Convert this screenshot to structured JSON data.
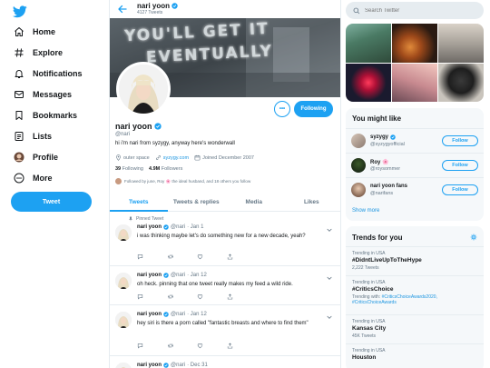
{
  "colors": {
    "accent": "#1da1f2",
    "text": "#14171a",
    "muted": "#657786",
    "border": "#e6ecf0",
    "panel": "#f5f8fa"
  },
  "nav": {
    "logo_icon": "twitter-bird-icon",
    "items": [
      {
        "label": "Home",
        "icon": "home-icon"
      },
      {
        "label": "Explore",
        "icon": "hashtag-icon"
      },
      {
        "label": "Notifications",
        "icon": "bell-icon"
      },
      {
        "label": "Messages",
        "icon": "envelope-icon"
      },
      {
        "label": "Bookmarks",
        "icon": "bookmark-icon"
      },
      {
        "label": "Lists",
        "icon": "list-icon"
      },
      {
        "label": "Profile",
        "icon": "avatar-icon"
      },
      {
        "label": "More",
        "icon": "more-circle-icon"
      }
    ],
    "tweet_button": "Tweet"
  },
  "header": {
    "name": "nari yoon",
    "tweet_count": "4127 Tweets"
  },
  "banner": {
    "line1": "YOU'LL GET IT",
    "line2": "EVENTUALLY"
  },
  "profile": {
    "name": "nari yoon",
    "handle": "@nari",
    "bio": "hi i'm nari from syzygy, anyway here's wonderwall",
    "location": "outer space",
    "website": "syzygy.com",
    "joined": "Joined December 2007",
    "following_count": "39",
    "following_label": "Following",
    "followers_count": "4.9M",
    "followers_label": "Followers",
    "followed_by": "Followed by june, Roy 🌸 the ideal husband, and 18 others you follow",
    "more_label": "•••",
    "following_button": "Following"
  },
  "tabs": [
    "Tweets",
    "Tweets & replies",
    "Media",
    "Likes"
  ],
  "tweets": [
    {
      "pinned": "Pinned Tweet",
      "name": "nari yoon",
      "handle": "@nari",
      "date": "· Jan 1",
      "text": "i was thinking maybe let's do something new for a new decade, yeah?"
    },
    {
      "pinned": "",
      "name": "nari yoon",
      "handle": "@nari",
      "date": "· Jan 12",
      "text": "oh heck. pinning that one tweet really makes my feed a wild ride."
    },
    {
      "pinned": "",
      "name": "nari yoon",
      "handle": "@nari",
      "date": "· Jan 12",
      "text": "hey siri is there a porn called \"fantastic breasts and where to find them\""
    },
    {
      "pinned": "",
      "name": "nari yoon",
      "handle": "@nari",
      "date": "· Dec 31",
      "text": ""
    }
  ],
  "search": {
    "placeholder": "Search Twitter"
  },
  "suggestions": {
    "title": "You might like",
    "items": [
      {
        "name": "syzygy",
        "handle": "@syzygyofficial",
        "button": "Follow"
      },
      {
        "name": "Roy 🌸",
        "handle": "@roysommer",
        "button": "Follow"
      },
      {
        "name": "nari yoon fans",
        "handle": "@narifans",
        "button": "Follow"
      }
    ],
    "show_more": "Show more"
  },
  "trends": {
    "title": "Trends for you",
    "items": [
      {
        "context": "Trending in USA",
        "name": "#DidntLiveUpToTheHype",
        "desc_prefix": "",
        "desc_highlight": "",
        "desc_suffix": "",
        "count": "2,222 Tweets"
      },
      {
        "context": "Trending in USA",
        "name": "#CriticsChoice",
        "desc_prefix": "Trending with: ",
        "desc_highlight": "#CriticsChoiceAwards2020, #CriticsChoiceAwards",
        "desc_suffix": "",
        "count": ""
      },
      {
        "context": "Trending in USA",
        "name": "Kansas City",
        "desc_prefix": "",
        "desc_highlight": "",
        "desc_suffix": "",
        "count": "45K Tweets"
      },
      {
        "context": "Trending in USA",
        "name": "Houston",
        "desc_prefix": "",
        "desc_highlight": "",
        "desc_suffix": "",
        "count": ""
      }
    ]
  }
}
